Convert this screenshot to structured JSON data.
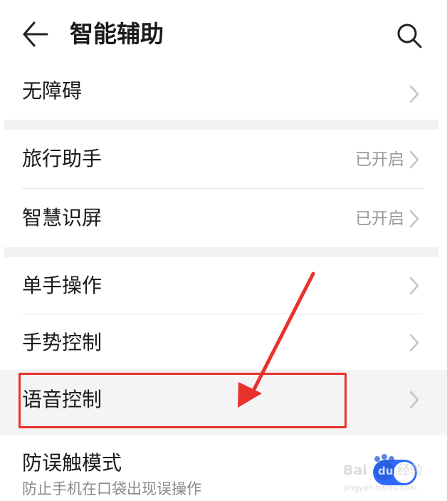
{
  "header": {
    "title": "智能辅助"
  },
  "icons": {
    "back": "arrow-left-icon",
    "search": "search-icon",
    "chevron": "chevron-right-icon"
  },
  "sections": [
    {
      "items": [
        {
          "label": "无障碍",
          "value": ""
        }
      ]
    },
    {
      "items": [
        {
          "label": "旅行助手",
          "value": "已开启"
        },
        {
          "label": "智慧识屏",
          "value": "已开启"
        }
      ]
    },
    {
      "items": [
        {
          "label": "单手操作",
          "value": ""
        },
        {
          "label": "手势控制",
          "value": ""
        },
        {
          "label": "语音控制",
          "value": ""
        },
        {
          "label": "防误触模式",
          "sublabel": "防止手机在口袋出现误操作",
          "toggle_on": true
        }
      ]
    }
  ],
  "annotation": {
    "color": "#e8322b"
  },
  "watermark": {
    "text": "Baidu经验",
    "subtext": "jingyan.baidu.com"
  },
  "colors": {
    "accent": "#2f6bff",
    "annotation_red": "#e8322b",
    "secondary_text": "#9a9a9a",
    "section_gap": "#f2f2f2"
  }
}
